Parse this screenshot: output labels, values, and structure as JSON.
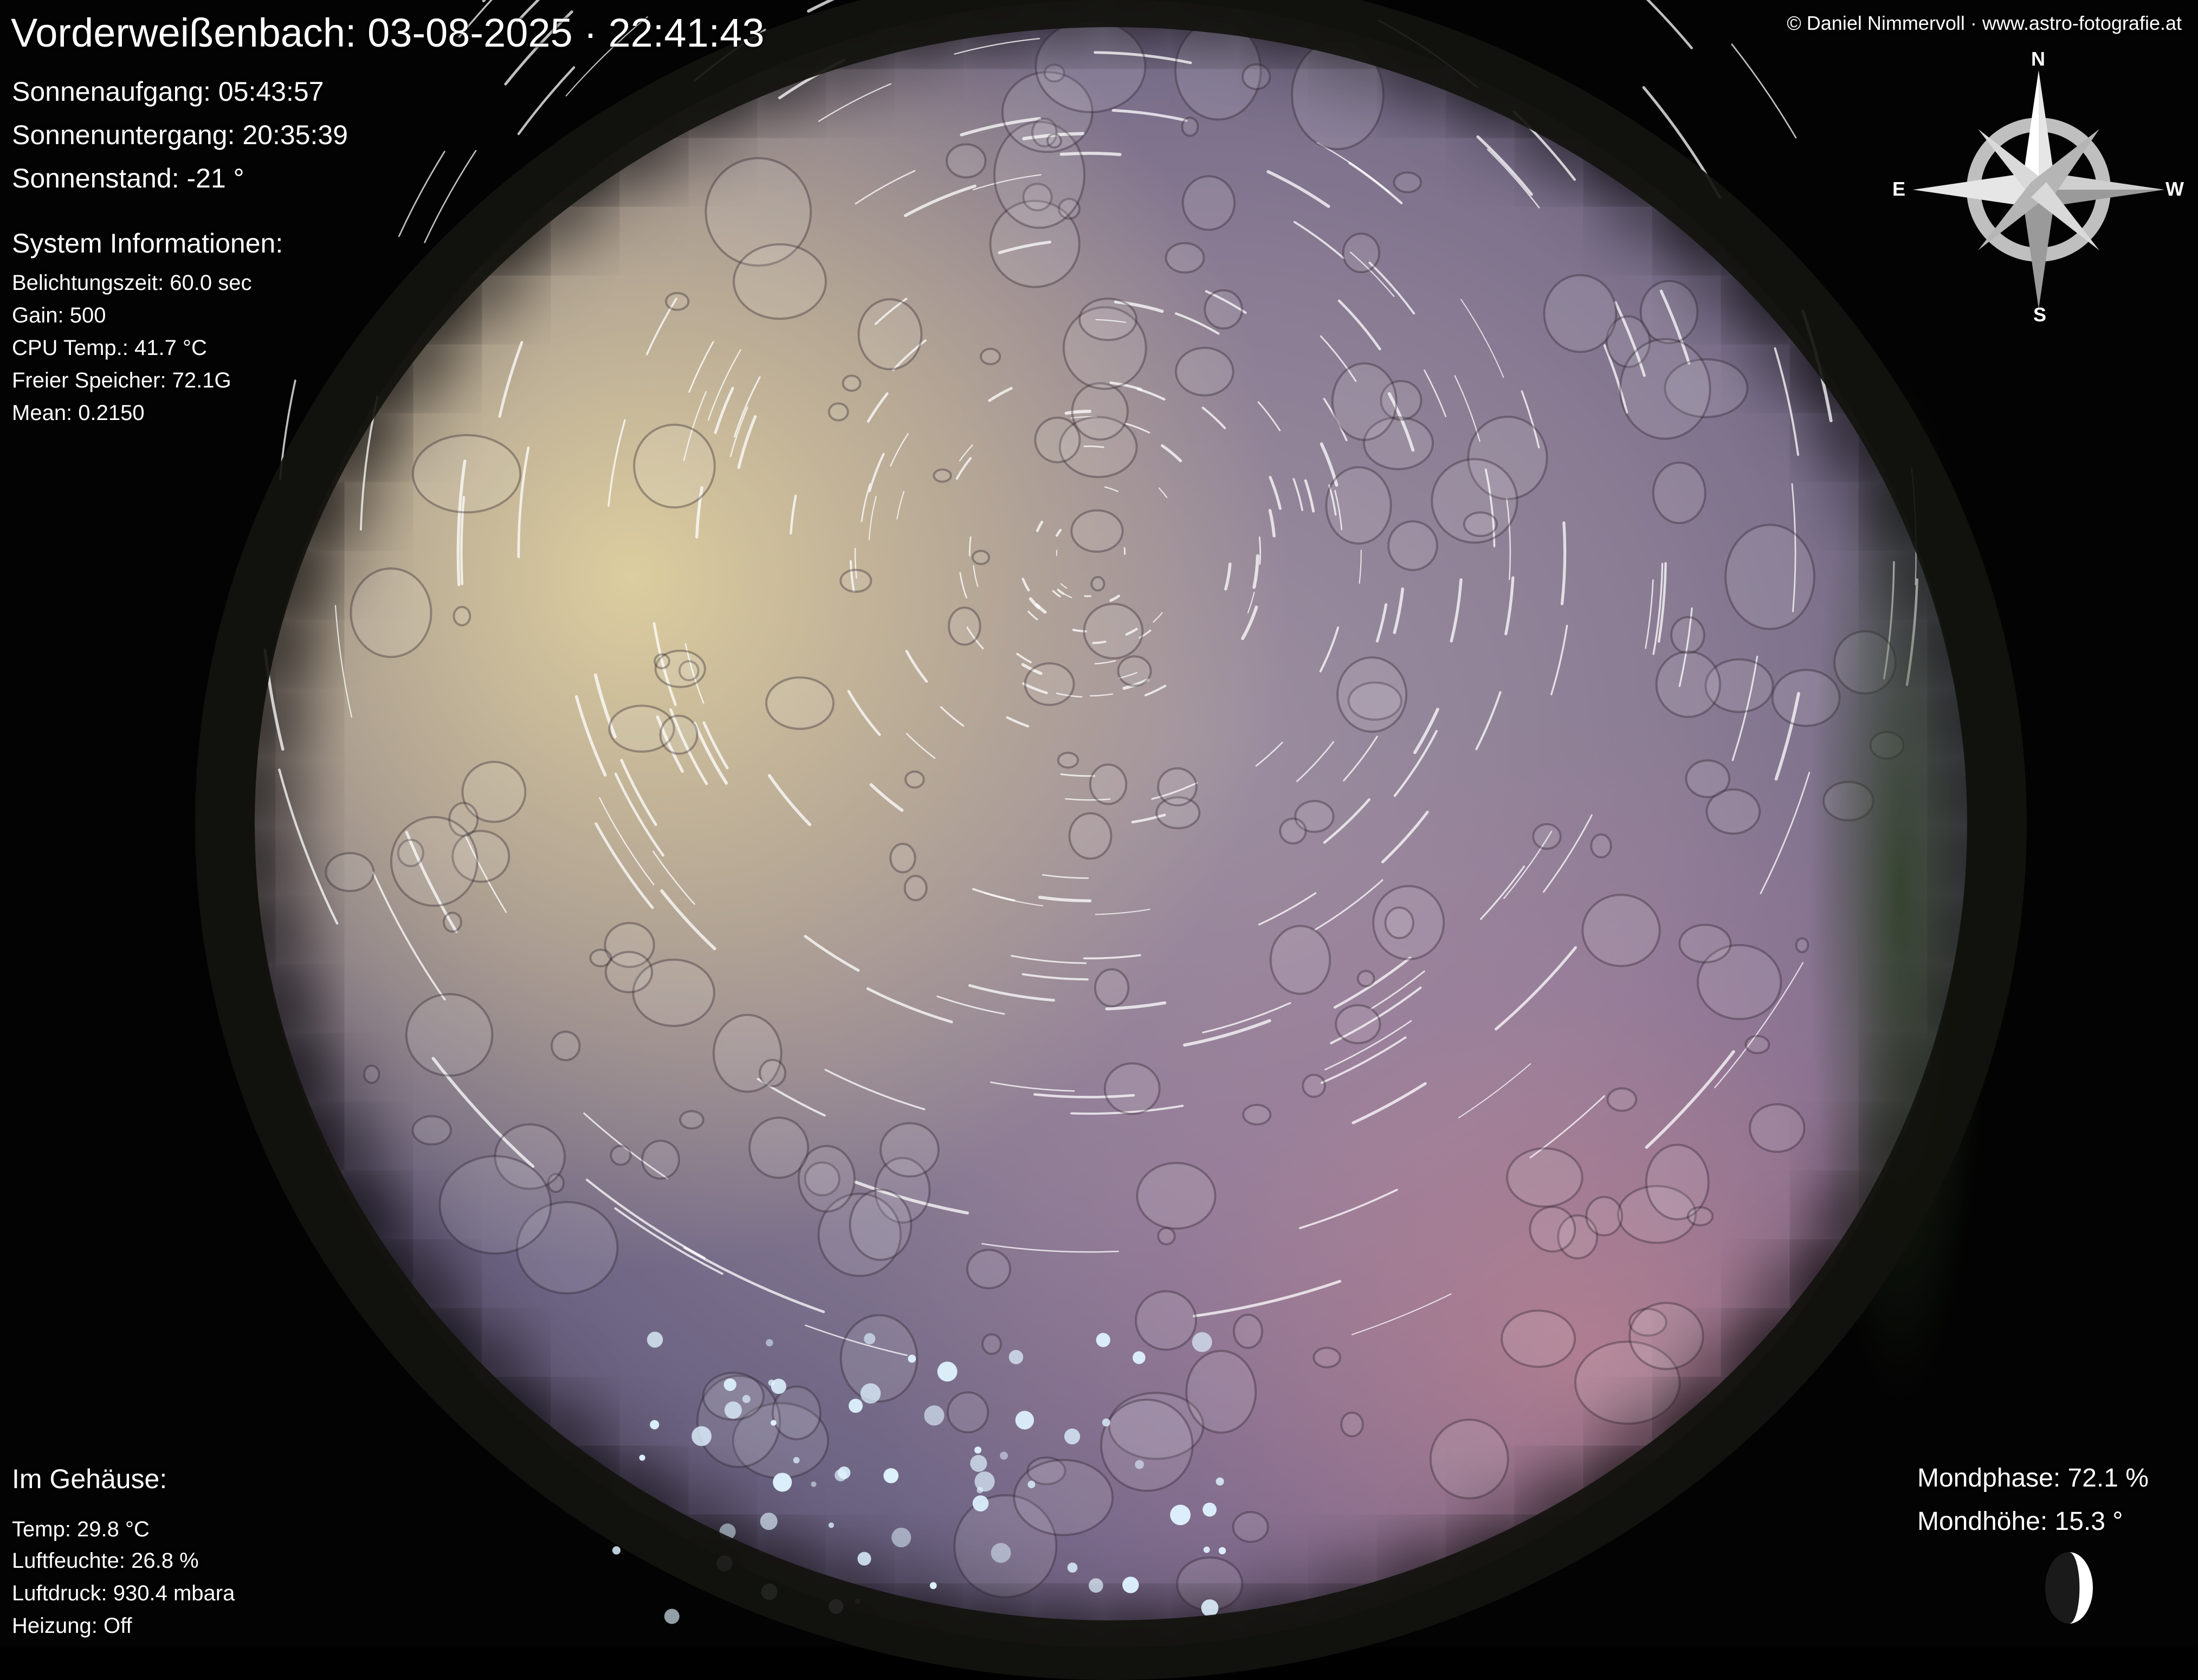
{
  "header": {
    "title": "Vorderweißenbach: 03-08-2025 · 22:41:43",
    "credit": "© Daniel Nimmervoll · www.astro-fotografie.at"
  },
  "sun": {
    "sunrise": "Sonnenaufgang: 05:43:57",
    "sunset": "Sonnenuntergang: 20:35:39",
    "altitude": "Sonnenstand: -21 °"
  },
  "system": {
    "heading": "System Informationen:",
    "exposure": "Belichtungszeit: 60.0 sec",
    "gain": "Gain: 500",
    "cpu_temp": "CPU Temp.: 41.7 °C",
    "free_storage": "Freier Speicher: 72.1G",
    "mean": "Mean: 0.2150"
  },
  "housing": {
    "heading": "Im Gehäuse:",
    "temp": "Temp: 29.8 °C",
    "humidity": "Luftfeuchte: 26.8 %",
    "pressure": "Luftdruck: 930.4 mbara",
    "heating": "Heizung: Off"
  },
  "moon": {
    "phase": "Mondphase: 72.1 %",
    "altitude": "Mondhöhe: 15.3 °",
    "illumination_fraction": 0.72
  },
  "compass": {
    "north": "N",
    "east": "E",
    "west": "W",
    "south": "S"
  },
  "colors": {
    "overlay_text": "#ffffff",
    "sky_warm": "#e1d2a0",
    "sky_violet": "#8a7c93",
    "horizon_pink": "#de8c96",
    "background": "#030303"
  }
}
